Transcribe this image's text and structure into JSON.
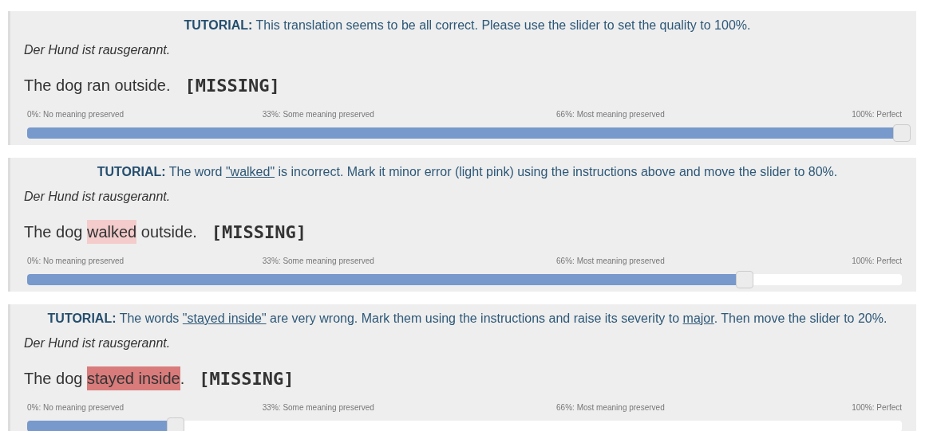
{
  "items": [
    {
      "tutorial": {
        "label": "TUTORIAL:",
        "parts": [
          {
            "text": " This translation seems to be all correct. Please use the slider to set the quality to 100%.",
            "underlined": false
          }
        ]
      },
      "source": "Der Hund ist rausgerannt.",
      "translation": [
        {
          "text": "The dog ran outside."
        }
      ],
      "missing": "[MISSING]",
      "scale": [
        "0%: No meaning preserved",
        "33%: Some meaning preserved",
        "66%: Most meaning preserved",
        "100%: Perfect"
      ],
      "slider": {
        "level": 1
      }
    },
    {
      "tutorial": {
        "label": "TUTORIAL:",
        "parts": [
          {
            "text": " The word ",
            "underlined": false
          },
          {
            "text": "\"walked\"",
            "underlined": true
          },
          {
            "text": " is incorrect. Mark it minor error (light pink) using the instructions above and move the slider to 80%.",
            "underlined": false
          }
        ]
      },
      "source": "Der Hund ist rausgerannt.",
      "translation": [
        {
          "text": "The dog "
        },
        {
          "text": "walked",
          "color": "#f4cccc"
        },
        {
          "text": " outside."
        }
      ],
      "missing": "[MISSING]",
      "scale": [
        "0%: No meaning preserved",
        "33%: Some meaning preserved",
        "66%: Most meaning preserved",
        "100%: Perfect"
      ],
      "slider": {
        "level": 0.82
      }
    },
    {
      "tutorial": {
        "label": "TUTORIAL:",
        "parts": [
          {
            "text": " The words ",
            "underlined": false
          },
          {
            "text": "\"stayed inside\"",
            "underlined": true
          },
          {
            "text": " are very wrong. Mark them using the instructions and raise its severity to ",
            "underlined": false
          },
          {
            "text": "major",
            "underlined": true
          },
          {
            "text": ". Then move the slider to 20%.",
            "underlined": false
          }
        ]
      },
      "source": "Der Hund ist rausgerannt.",
      "translation": [
        {
          "text": "The dog "
        },
        {
          "text": "stayed inside",
          "color": "#d97b7b"
        },
        {
          "text": "."
        }
      ],
      "missing": "[MISSING]",
      "scale": [
        "0%: No meaning preserved",
        "33%: Some meaning preserved",
        "66%: Most meaning preserved",
        "100%: Perfect"
      ],
      "slider": {
        "level": 0.17
      }
    }
  ]
}
